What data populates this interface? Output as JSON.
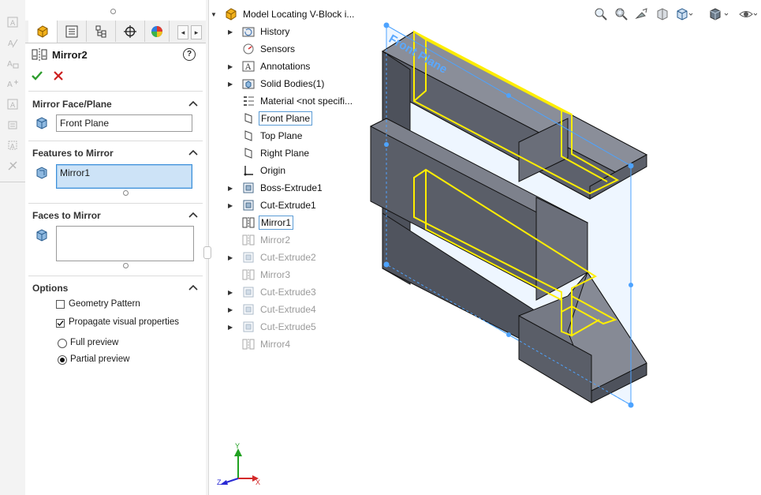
{
  "property_manager": {
    "title": "Mirror2",
    "help_label": "?",
    "mirror_face_plane": {
      "heading": "Mirror Face/Plane",
      "value": "Front Plane"
    },
    "features_to_mirror": {
      "heading": "Features to Mirror",
      "value": "Mirror1"
    },
    "faces_to_mirror": {
      "heading": "Faces to Mirror",
      "value": ""
    },
    "options": {
      "heading": "Options",
      "geometry_pattern": {
        "label": "Geometry Pattern",
        "checked": false
      },
      "propagate_visual": {
        "label": "Propagate visual properties",
        "checked": true
      },
      "full_preview": {
        "label": "Full preview",
        "selected": false
      },
      "partial_preview": {
        "label": "Partial preview",
        "selected": true
      }
    },
    "tabs": [
      "feature-manager-tab",
      "property-manager-tab",
      "configuration-manager-tab",
      "dimxpert-tab",
      "display-manager-tab"
    ],
    "tab_nav": {
      "prev": "◂",
      "next": "▸"
    }
  },
  "tree": {
    "root": "Model Locating V-Block i...",
    "items": [
      {
        "label": "History",
        "icon": "history-folder-icon",
        "expandable": true,
        "dim": false
      },
      {
        "label": "Sensors",
        "icon": "sensors-icon",
        "expandable": false,
        "dim": false
      },
      {
        "label": "Annotations",
        "icon": "annotations-icon",
        "expandable": true,
        "dim": false
      },
      {
        "label": "Solid Bodies(1)",
        "icon": "solid-bodies-icon",
        "expandable": true,
        "dim": false
      },
      {
        "label": "Material <not specifi...",
        "icon": "material-icon",
        "expandable": false,
        "dim": false
      },
      {
        "label": "Front Plane",
        "icon": "plane-icon",
        "expandable": false,
        "dim": false,
        "boxed": true
      },
      {
        "label": "Top Plane",
        "icon": "plane-icon",
        "expandable": false,
        "dim": false
      },
      {
        "label": "Right Plane",
        "icon": "plane-icon",
        "expandable": false,
        "dim": false
      },
      {
        "label": "Origin",
        "icon": "origin-icon",
        "expandable": false,
        "dim": false
      },
      {
        "label": "Boss-Extrude1",
        "icon": "extrude-icon",
        "expandable": true,
        "dim": false
      },
      {
        "label": "Cut-Extrude1",
        "icon": "extrude-icon",
        "expandable": true,
        "dim": false
      },
      {
        "label": "Mirror1",
        "icon": "mirror-icon",
        "expandable": false,
        "dim": false,
        "boxed": true
      },
      {
        "label": "Mirror2",
        "icon": "mirror-icon",
        "expandable": false,
        "dim": true
      },
      {
        "label": "Cut-Extrude2",
        "icon": "extrude-icon",
        "expandable": true,
        "dim": true
      },
      {
        "label": "Mirror3",
        "icon": "mirror-icon",
        "expandable": false,
        "dim": true
      },
      {
        "label": "Cut-Extrude3",
        "icon": "extrude-icon",
        "expandable": true,
        "dim": true
      },
      {
        "label": "Cut-Extrude4",
        "icon": "extrude-icon",
        "expandable": true,
        "dim": true
      },
      {
        "label": "Cut-Extrude5",
        "icon": "extrude-icon",
        "expandable": true,
        "dim": true
      },
      {
        "label": "Mirror4",
        "icon": "mirror-icon",
        "expandable": false,
        "dim": true
      }
    ]
  },
  "viewport": {
    "plane_label": "Front Plane",
    "triad": {
      "x": "X",
      "y": "Y",
      "z": "Z"
    },
    "toolbar_icons": [
      "zoom-to-fit-icon",
      "zoom-to-area-icon",
      "previous-view-icon",
      "section-view-icon",
      "view-orientation-icon",
      "display-style-icon",
      "hide-show-items-icon"
    ]
  },
  "colors": {
    "accent": "#3c8fd9",
    "preview_yellow": "#ffee00",
    "part_gray": "#5f6270",
    "plane_blue": "#4da3ff",
    "ok_green": "#2e9d2e",
    "cancel_red": "#cc1f1f"
  }
}
